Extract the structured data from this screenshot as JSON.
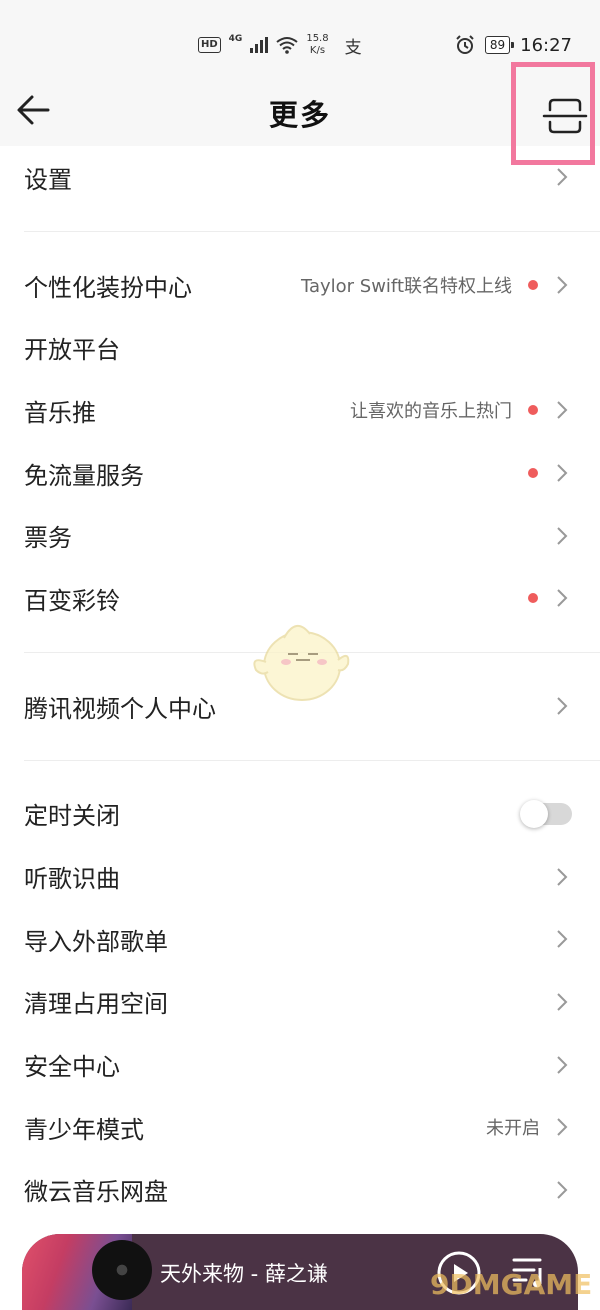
{
  "status_bar": {
    "hd": "HD",
    "network": "4G",
    "speed_value": "15.8",
    "speed_unit": "K/s",
    "pay_glyph": "支",
    "battery": "89",
    "time": "16:27"
  },
  "header": {
    "title": "更多",
    "back_icon": "arrow-left-icon",
    "scan_icon": "scan-icon"
  },
  "sections": [
    {
      "items": [
        {
          "label": "设置",
          "subtitle": "",
          "dot": false,
          "chevron": true
        }
      ]
    },
    {
      "items": [
        {
          "label": "个性化装扮中心",
          "subtitle": "Taylor Swift联名特权上线",
          "dot": true,
          "chevron": true
        },
        {
          "label": "开放平台",
          "subtitle": "",
          "dot": false,
          "chevron": false
        },
        {
          "label": "音乐推",
          "subtitle": "让喜欢的音乐上热门",
          "dot": true,
          "chevron": true
        },
        {
          "label": "免流量服务",
          "subtitle": "",
          "dot": true,
          "chevron": true
        },
        {
          "label": "票务",
          "subtitle": "",
          "dot": false,
          "chevron": true
        },
        {
          "label": "百变彩铃",
          "subtitle": "",
          "dot": true,
          "chevron": true
        }
      ]
    },
    {
      "items": [
        {
          "label": "腾讯视频个人中心",
          "subtitle": "",
          "dot": false,
          "chevron": true
        }
      ]
    },
    {
      "items": [
        {
          "label": "定时关闭",
          "subtitle": "",
          "dot": false,
          "chevron": false,
          "toggle": true,
          "toggle_on": false
        },
        {
          "label": "听歌识曲",
          "subtitle": "",
          "dot": false,
          "chevron": true
        },
        {
          "label": "导入外部歌单",
          "subtitle": "",
          "dot": false,
          "chevron": true
        },
        {
          "label": "清理占用空间",
          "subtitle": "",
          "dot": false,
          "chevron": true
        },
        {
          "label": "安全中心",
          "subtitle": "",
          "dot": false,
          "chevron": true
        },
        {
          "label": "青少年模式",
          "subtitle": "未开启",
          "dot": false,
          "chevron": true
        },
        {
          "label": "微云音乐网盘",
          "subtitle": "",
          "dot": false,
          "chevron": true
        }
      ]
    }
  ],
  "player": {
    "song": "天外来物 - 薛之谦",
    "play_icon": "play-icon",
    "playlist_icon": "playlist-icon"
  },
  "watermark": "9DMGAME",
  "colors": {
    "accent_dot": "#ef5c5c",
    "highlight": "#f2789e",
    "player_bg": "#4b3345"
  }
}
